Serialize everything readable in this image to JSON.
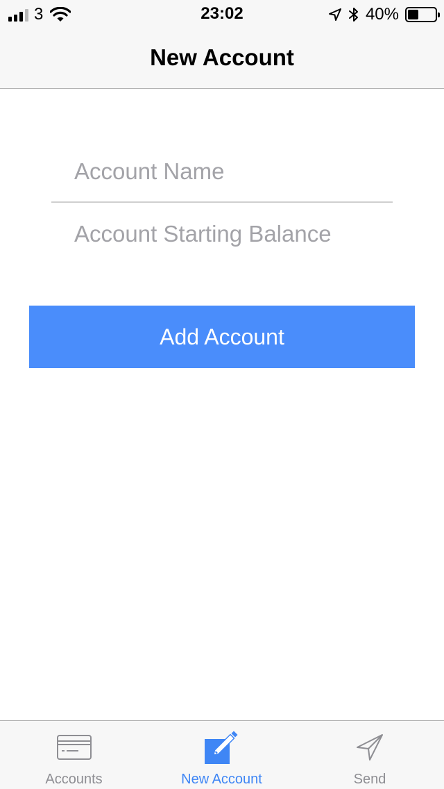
{
  "status_bar": {
    "carrier": "3",
    "time": "23:02",
    "battery_percent": "40%",
    "battery_level": 0.4,
    "signal_bars_filled": 3,
    "signal_bars_total": 4,
    "icons": [
      "signal-icon",
      "wifi-icon",
      "location-arrow-icon",
      "bluetooth-icon",
      "battery-icon"
    ]
  },
  "nav_bar": {
    "title": "New Account"
  },
  "form": {
    "account_name": {
      "value": "",
      "placeholder": "Account Name"
    },
    "starting_balance": {
      "value": "",
      "placeholder": "Account Starting Balance"
    },
    "submit_label": "Add Account"
  },
  "tab_bar": {
    "active_tab": "New Account",
    "tabs": [
      {
        "label": "Accounts",
        "icon": "credit-card-icon"
      },
      {
        "label": "New Account",
        "icon": "compose-icon"
      },
      {
        "label": "Send",
        "icon": "send-icon"
      }
    ]
  },
  "colors": {
    "accent": "#4a8dfb",
    "tab_active": "#3f86f5",
    "tab_inactive": "#8e8e93",
    "placeholder": "#a3a3a8",
    "bar_background": "#f7f7f7"
  }
}
